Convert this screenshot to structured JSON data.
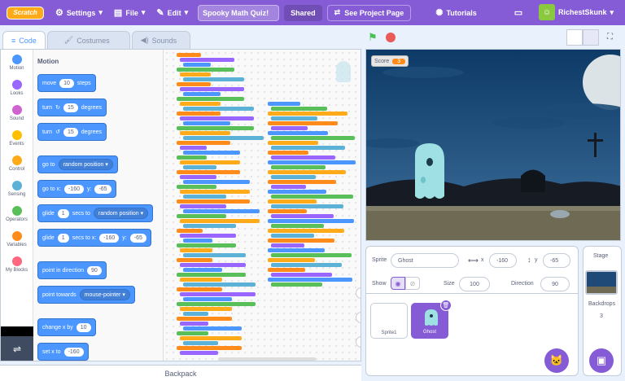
{
  "menubar": {
    "logo": "Scratch",
    "settings": "Settings",
    "file": "File",
    "edit": "Edit",
    "project_title": "Spooky Math Quiz!",
    "shared": "Shared",
    "see_project": "See Project Page",
    "tutorials": "Tutorials",
    "username": "RichestSkunk"
  },
  "tabs": {
    "code": "Code",
    "costumes": "Costumes",
    "sounds": "Sounds"
  },
  "categories": [
    {
      "label": "Motion",
      "color": "#4c97ff"
    },
    {
      "label": "Looks",
      "color": "#9966ff"
    },
    {
      "label": "Sound",
      "color": "#cf63cf"
    },
    {
      "label": "Events",
      "color": "#ffbf00"
    },
    {
      "label": "Control",
      "color": "#ffab19"
    },
    {
      "label": "Sensing",
      "color": "#5cb1d6"
    },
    {
      "label": "Operators",
      "color": "#59c059"
    },
    {
      "label": "Variables",
      "color": "#ff8c1a"
    },
    {
      "label": "My Blocks",
      "color": "#ff6680"
    }
  ],
  "palette": {
    "heading": "Motion",
    "move": {
      "pre": "move",
      "val": "10",
      "post": "steps"
    },
    "turn_cw": {
      "pre": "turn",
      "val": "15",
      "post": "degrees"
    },
    "turn_ccw": {
      "pre": "turn",
      "val": "15",
      "post": "degrees"
    },
    "goto": {
      "pre": "go to",
      "dd": "random position"
    },
    "goto_xy": {
      "pre": "go to x:",
      "x": "-160",
      "ylbl": "y:",
      "y": "-65"
    },
    "glide_rand": {
      "pre": "glide",
      "val": "1",
      "mid": "secs to",
      "dd": "random position"
    },
    "glide_xy": {
      "pre": "glide",
      "val": "1",
      "mid": "secs to x:",
      "x": "-160",
      "ylbl": "y:",
      "y": "-65"
    },
    "point_dir": {
      "pre": "point in direction",
      "val": "90"
    },
    "point_towards": {
      "pre": "point towards",
      "dd": "mouse-pointer"
    },
    "change_x": {
      "pre": "change x by",
      "val": "10"
    },
    "set_x": {
      "pre": "set x to",
      "val": "-160"
    }
  },
  "backpack": "Backpack",
  "stage": {
    "score_label": "Score",
    "score_value": "3"
  },
  "sprite_info": {
    "sprite_label": "Sprite",
    "sprite_name": "Ghost",
    "x_label": "x",
    "x": "-160",
    "y_label": "y",
    "y": "-65",
    "show_label": "Show",
    "size_label": "Size",
    "size": "100",
    "direction_label": "Direction",
    "direction": "90"
  },
  "sprites": [
    {
      "name": "Sprite1"
    },
    {
      "name": "Ghost"
    }
  ],
  "stage_panel": {
    "title": "Stage",
    "backdrops_label": "Backdrops",
    "backdrops_count": "3"
  }
}
